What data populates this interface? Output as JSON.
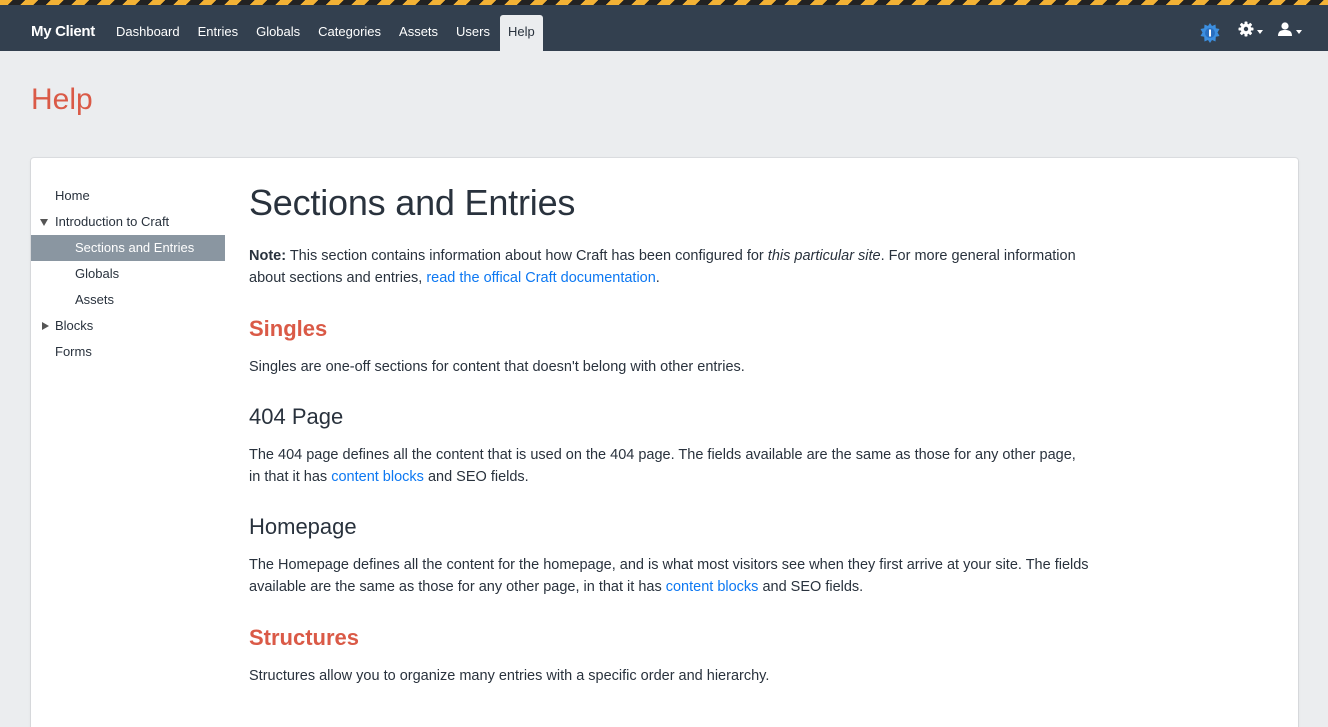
{
  "header": {
    "brand": "My Client",
    "nav": [
      "Dashboard",
      "Entries",
      "Globals",
      "Categories",
      "Assets",
      "Users",
      "Help"
    ],
    "active_nav": "Help",
    "icons": [
      "update-badge-icon",
      "gear-icon",
      "user-icon"
    ],
    "colors": {
      "bar": "#33404f",
      "hazard_yellow": "#f3b235",
      "badge_blue": "#3c8fe0"
    }
  },
  "page": {
    "title": "Help",
    "title_color": "#da5a47"
  },
  "sidebar": {
    "items": [
      {
        "label": "Home"
      },
      {
        "label": "Introduction to Craft"
      },
      {
        "label": "Sections and Entries"
      },
      {
        "label": "Globals"
      },
      {
        "label": "Assets"
      },
      {
        "label": "Blocks"
      },
      {
        "label": "Forms"
      }
    ],
    "selected": "Sections and Entries"
  },
  "content": {
    "title": "Sections and Entries",
    "note": {
      "bold": "Note:",
      "text1": " This section contains information about how Craft has been configured for ",
      "em": "this particular site",
      "text2": ". For more general information about sections and entries, ",
      "link": "read the offical Craft documentation",
      "text3": "."
    },
    "singles": {
      "heading": "Singles",
      "text": "Singles are one-off sections for content that doesn't belong with other entries."
    },
    "page404": {
      "heading": "404 Page",
      "text1": "The 404 page defines all the content that is used on the 404 page. The fields available are the same as those for any other page, in that it has ",
      "link": "content blocks",
      "text2": " and SEO fields."
    },
    "homepage": {
      "heading": "Homepage",
      "text1": "The Homepage defines all the content for the homepage, and is what most visitors see when they first arrive at your site. The fields available are the same as those for any other page, in that it has ",
      "link": "content blocks",
      "text2": " and SEO fields."
    },
    "structures": {
      "heading": "Structures",
      "text": "Structures allow you to organize many entries with a specific order and hierarchy."
    }
  }
}
